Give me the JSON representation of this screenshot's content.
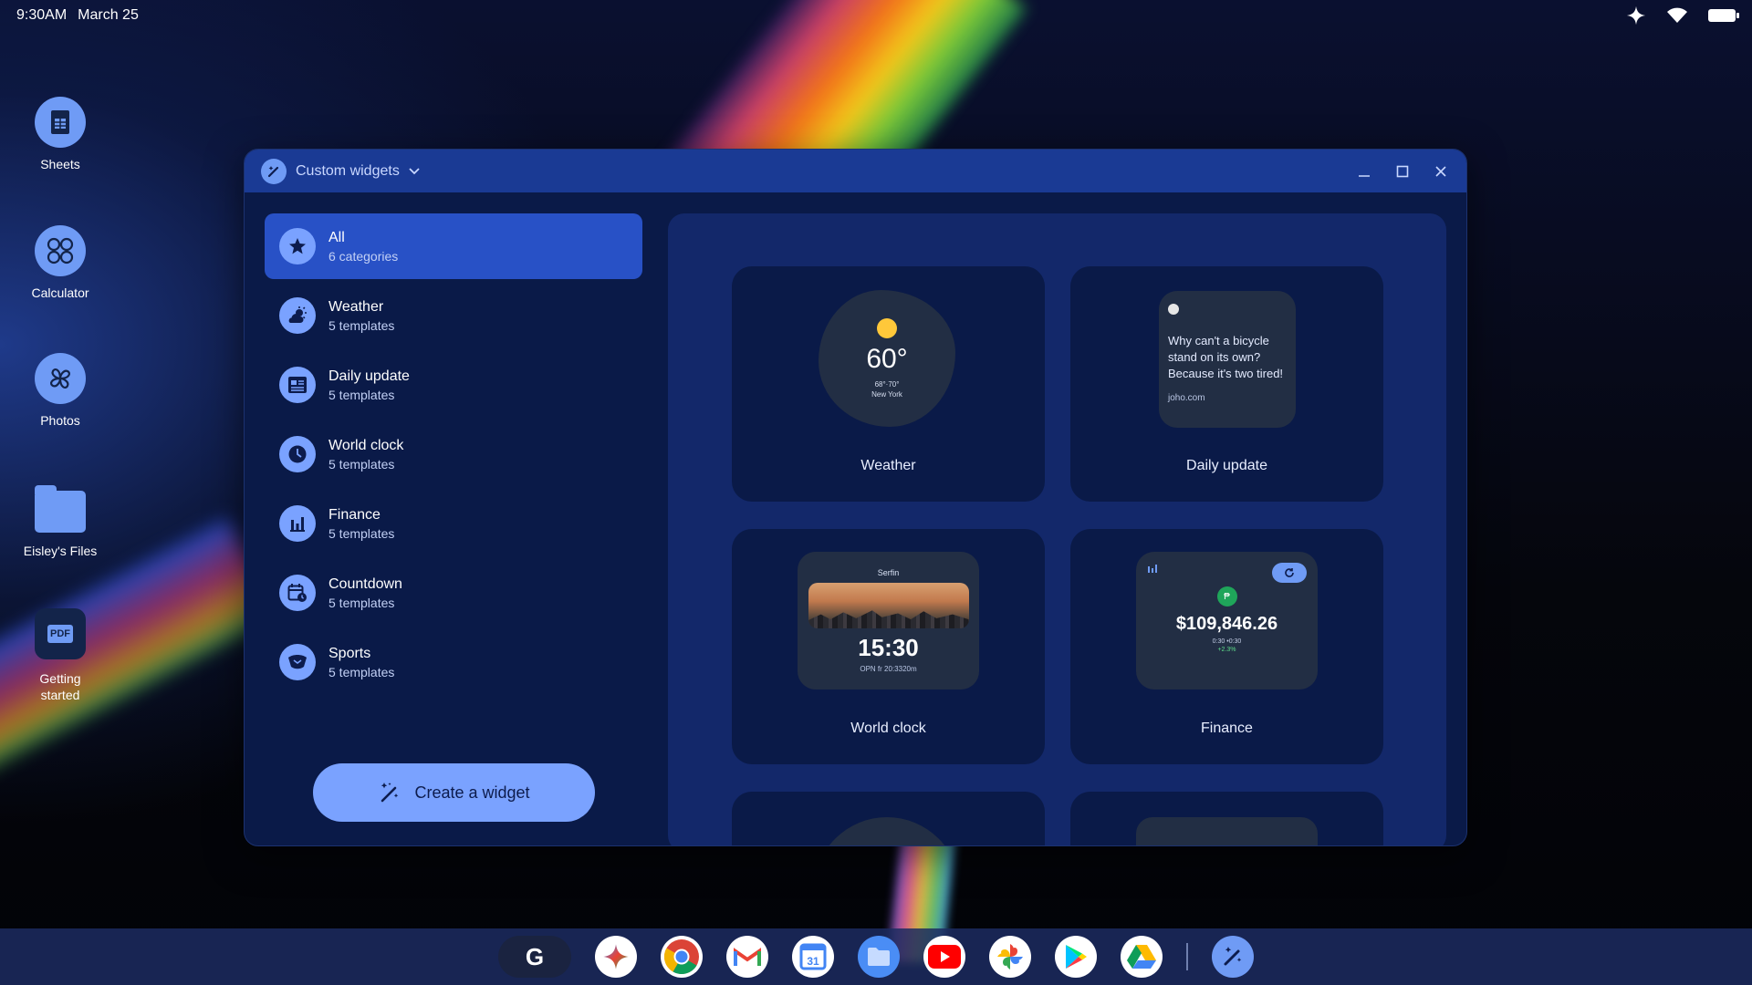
{
  "status": {
    "time": "9:30AM",
    "date": "March 25"
  },
  "desktop": {
    "icons": [
      {
        "label": "Sheets",
        "icon": "sheets-icon"
      },
      {
        "label": "Calculator",
        "icon": "calculator-icon"
      },
      {
        "label": "Photos",
        "icon": "photos-icon"
      },
      {
        "label": "Eisley's Files",
        "icon": "folder-icon"
      },
      {
        "label": "Getting started",
        "icon": "pdf-icon",
        "badge": "PDF"
      }
    ]
  },
  "window": {
    "title": "Custom widgets",
    "categories": [
      {
        "name": "All",
        "sub": "6 categories",
        "icon": "star-icon"
      },
      {
        "name": "Weather",
        "sub": "5 templates",
        "icon": "weather-icon"
      },
      {
        "name": "Daily update",
        "sub": "5 templates",
        "icon": "news-icon"
      },
      {
        "name": "World clock",
        "sub": "5 templates",
        "icon": "clock-icon"
      },
      {
        "name": "Finance",
        "sub": "5 templates",
        "icon": "bar-chart-icon"
      },
      {
        "name": "Countdown",
        "sub": "5 templates",
        "icon": "calendar-clock-icon"
      },
      {
        "name": "Sports",
        "sub": "5 templates",
        "icon": "sports-icon"
      }
    ],
    "create_label": "Create a widget",
    "cards": {
      "weather": {
        "label": "Weather",
        "temp": "60°",
        "hl": "68°·70°",
        "city": "New York"
      },
      "daily": {
        "label": "Daily update",
        "text": "Why can't a bicycle stand on its own? Because it's two tired!",
        "source": "joho.com"
      },
      "clock": {
        "label": "World clock",
        "city": "Serfin",
        "time": "15:30",
        "meta": "OPN fr 20:3320m"
      },
      "finance": {
        "label": "Finance",
        "value": "$109,846.26",
        "meta": "0:30 •0:30",
        "change": "+2.3%"
      }
    }
  },
  "shelf": {
    "launcher": "G",
    "apps": [
      "gemini-icon",
      "chrome-icon",
      "gmail-icon",
      "calendar-icon",
      "files-icon",
      "youtube-icon",
      "photos-icon",
      "play-store-icon",
      "drive-icon"
    ],
    "calendar_day": "31",
    "pinned": "custom-widgets-icon"
  },
  "colors": {
    "accent": "#6f9bf5",
    "active_bg": "#2851c6",
    "window_bg": "#0a1a48",
    "titlebar": "#1a3a94"
  }
}
